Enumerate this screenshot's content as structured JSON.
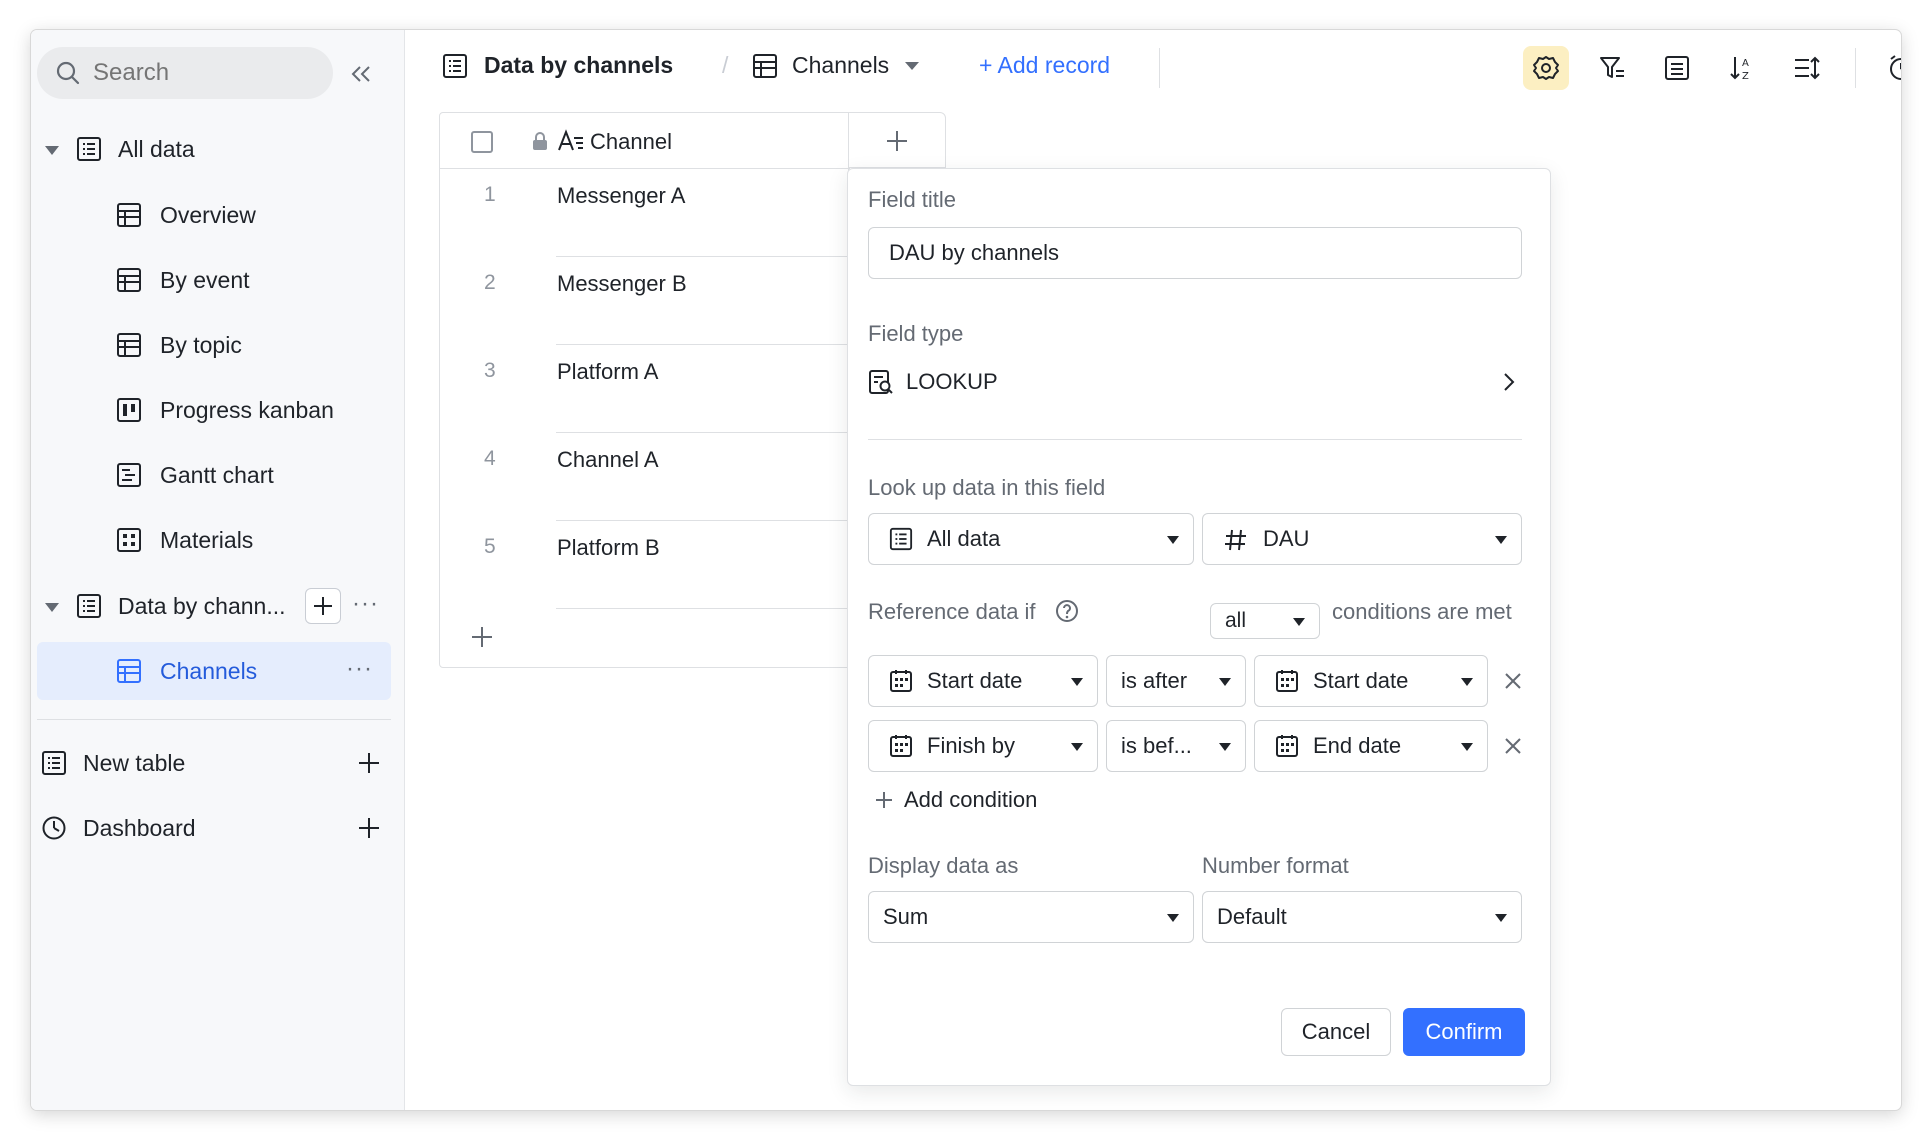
{
  "sidebar": {
    "search_placeholder": "Search",
    "sections": [
      {
        "label": "All data"
      },
      {
        "label": "Data by chann..."
      }
    ],
    "views": [
      {
        "label": "Overview"
      },
      {
        "label": "By event"
      },
      {
        "label": "By topic"
      },
      {
        "label": "Progress kanban"
      },
      {
        "label": "Gantt chart"
      },
      {
        "label": "Materials"
      }
    ],
    "active_view": "Channels",
    "footer": [
      {
        "label": "New table"
      },
      {
        "label": "Dashboard"
      }
    ]
  },
  "toolbar": {
    "table_name": "Data by channels",
    "separator": "/",
    "view_name": "Channels",
    "add_record": "+ Add record"
  },
  "grid": {
    "column_header": "Channel",
    "rows": [
      {
        "num": "1",
        "value": "Messenger A"
      },
      {
        "num": "2",
        "value": "Messenger B"
      },
      {
        "num": "3",
        "value": "Platform A"
      },
      {
        "num": "4",
        "value": "Channel A"
      },
      {
        "num": "5",
        "value": "Platform B"
      }
    ]
  },
  "panel": {
    "field_title_label": "Field title",
    "field_title_value": "DAU by channels",
    "field_type_label": "Field type",
    "field_type_value": "LOOKUP",
    "lookup_label": "Look up data in this field",
    "lookup_table": "All data",
    "lookup_field": "DAU",
    "reference_label": "Reference data if",
    "match_mode": "all",
    "conditions_suffix": "conditions are met",
    "conditions": [
      {
        "field": "Start date",
        "operator": "is after",
        "value": "Start date"
      },
      {
        "field": "Finish by",
        "operator": "is bef...",
        "value": "End date"
      }
    ],
    "add_condition": "Add condition",
    "display_label": "Display data as",
    "display_value": "Sum",
    "format_label": "Number format",
    "format_value": "Default",
    "cancel": "Cancel",
    "confirm": "Confirm"
  },
  "colors": {
    "accent": "#3370ff",
    "active_bg": "#e5edfd",
    "active_text": "#245bdb",
    "settings_highlight": "#fcefc2"
  }
}
